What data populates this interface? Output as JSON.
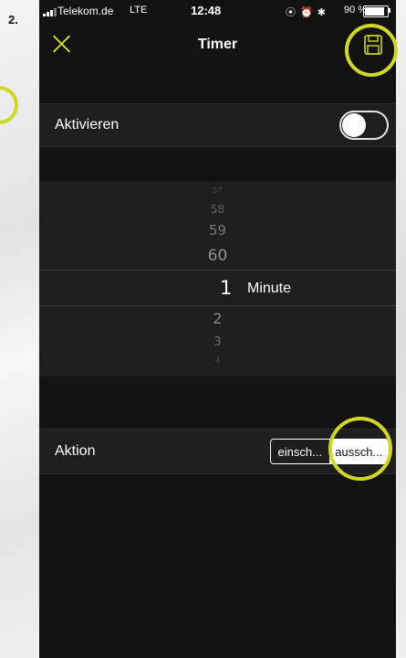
{
  "annotation": {
    "step_number": "2.",
    "marker_color": "#cfd82a"
  },
  "status_bar": {
    "carrier": "Telekom.de",
    "network": "LTE",
    "time": "12:48",
    "status_icons": "⦿ ⏰ ✱",
    "battery_percent": "90 %"
  },
  "nav": {
    "title": "Timer",
    "close_icon": "close-icon",
    "save_icon": "floppy-disk-icon",
    "accent_color": "#cfd82a"
  },
  "activate": {
    "label": "Aktivieren",
    "enabled": false
  },
  "picker": {
    "above": [
      "57",
      "58",
      "59",
      "60"
    ],
    "selected_value": "1",
    "unit": "Minute",
    "below": [
      "2",
      "3",
      "4"
    ]
  },
  "action": {
    "label": "Aktion",
    "options": [
      "einsch...",
      "aussch..."
    ],
    "selected": "aussch..."
  }
}
